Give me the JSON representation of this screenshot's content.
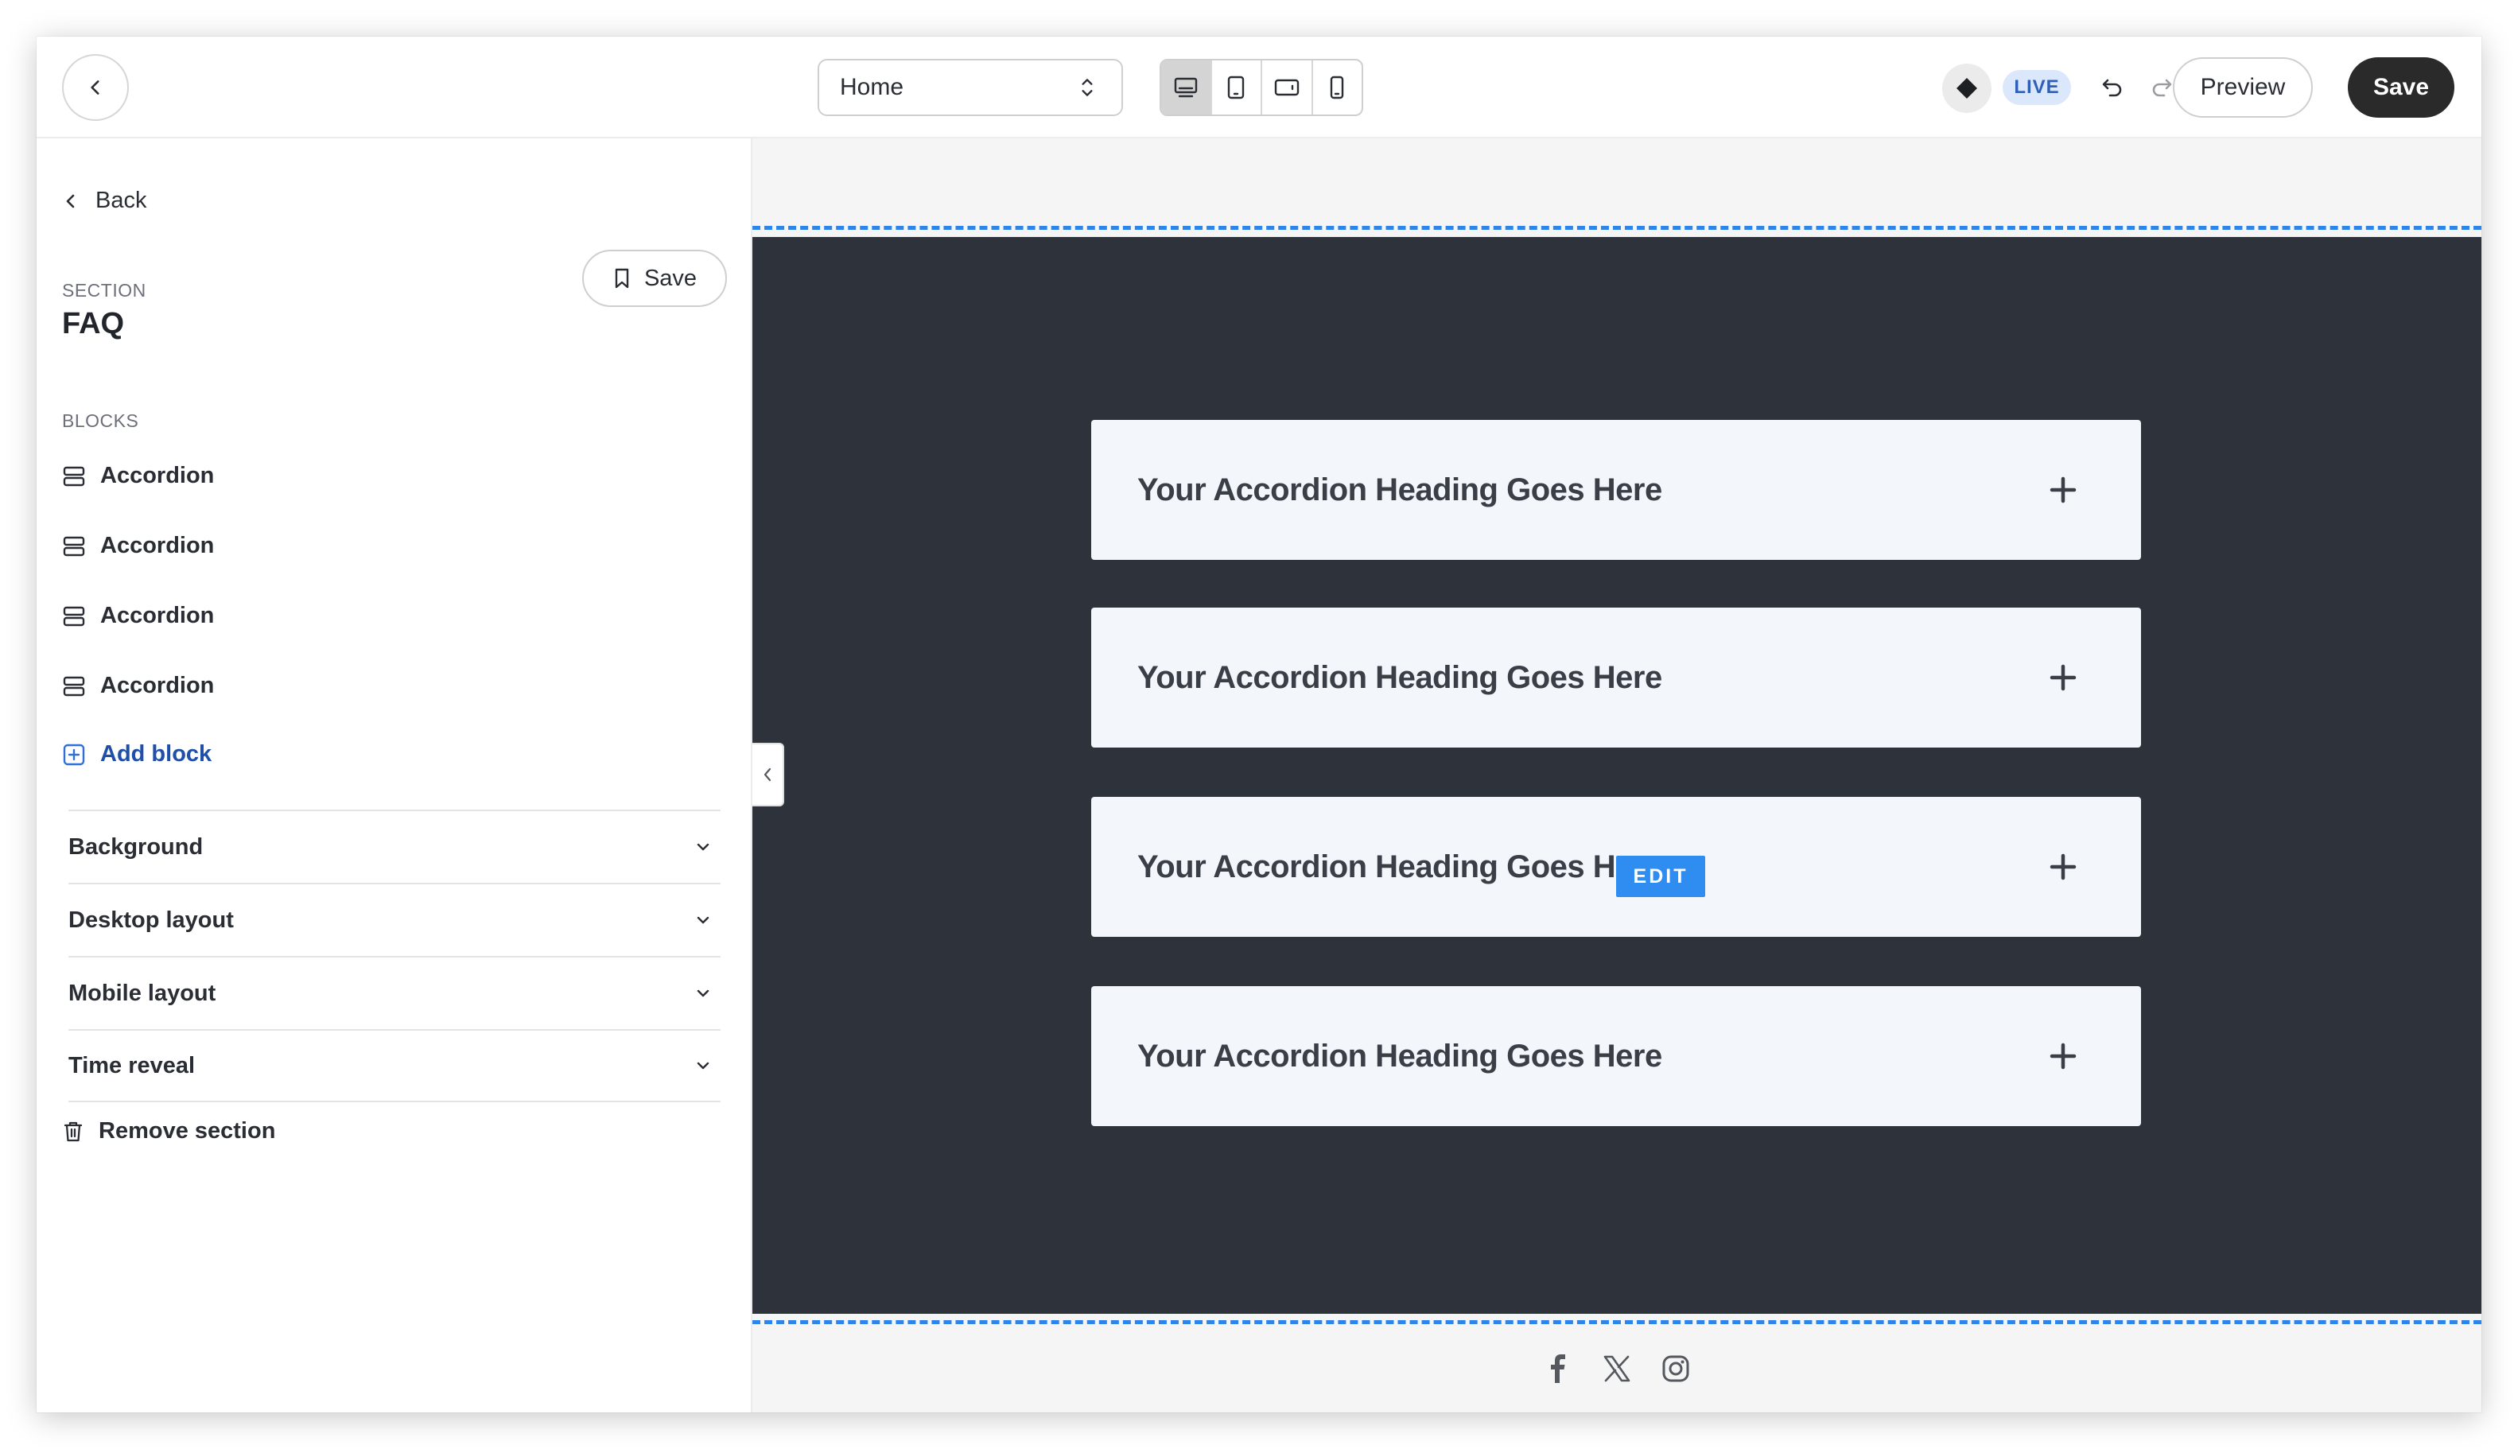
{
  "topbar": {
    "page_select": {
      "value": "Home"
    },
    "devices": [
      "desktop",
      "tablet",
      "tablet-landscape",
      "mobile"
    ],
    "active_device": "desktop",
    "live_label": "LIVE",
    "preview_label": "Preview",
    "save_label": "Save"
  },
  "sidebar": {
    "back_label": "Back",
    "section_kicker": "SECTION",
    "section_title": "FAQ",
    "save_label": "Save",
    "blocks_kicker": "BLOCKS",
    "blocks": [
      {
        "label": "Accordion",
        "icon": "accordion-icon"
      },
      {
        "label": "Accordion",
        "icon": "accordion-icon"
      },
      {
        "label": "Accordion",
        "icon": "accordion-icon"
      },
      {
        "label": "Accordion",
        "icon": "accordion-icon"
      }
    ],
    "add_block_label": "Add block",
    "settings": [
      {
        "label": "Background"
      },
      {
        "label": "Desktop layout"
      },
      {
        "label": "Mobile layout"
      },
      {
        "label": "Time reveal"
      }
    ],
    "remove_label": "Remove section"
  },
  "canvas": {
    "accordions": [
      {
        "title": "Your Accordion Heading Goes Here",
        "icon": "plus-icon"
      },
      {
        "title": "Your Accordion Heading Goes Here",
        "icon": "plus-icon"
      },
      {
        "title": "Your Accordion Heading Goes Here",
        "icon": "plus-icon"
      },
      {
        "title": "Your Accordion Heading Goes Here",
        "icon": "plus-icon"
      }
    ],
    "edit_label": "EDIT",
    "social_icons": [
      "facebook-icon",
      "x-icon",
      "instagram-icon"
    ]
  },
  "colors": {
    "accent": "#2f8cf0",
    "dark_section": "#2e323a",
    "card_bg": "#f3f7fc",
    "primary_button": "#2a2a2a",
    "link_blue": "#1f4fa8",
    "live_badge_bg": "#dbe7fb"
  }
}
